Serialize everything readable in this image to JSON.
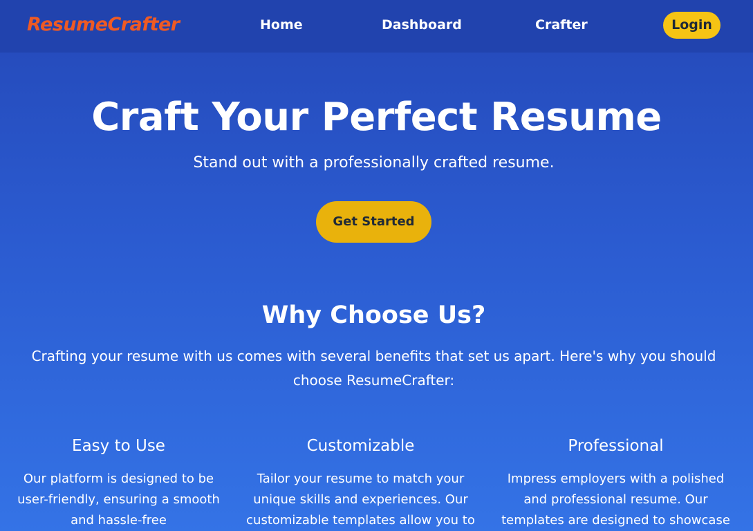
{
  "nav": {
    "brand": "ResumeCrafter",
    "links": [
      {
        "label": "Home"
      },
      {
        "label": "Dashboard"
      },
      {
        "label": "Crafter"
      }
    ],
    "login_label": "Login"
  },
  "hero": {
    "title": "Craft Your Perfect Resume",
    "subtitle": "Stand out with a professionally crafted resume.",
    "cta_label": "Get Started"
  },
  "why": {
    "title": "Why Choose Us?",
    "description": "Crafting your resume with us comes with several benefits that set us apart. Here's why you should choose ResumeCrafter:",
    "features": [
      {
        "title": "Easy to Use",
        "text": "Our platform is designed to be user-friendly, ensuring a smooth and hassle-free"
      },
      {
        "title": "Customizable",
        "text": "Tailor your resume to match your unique skills and experiences. Our customizable templates allow you to"
      },
      {
        "title": "Professional",
        "text": "Impress employers with a polished and professional resume. Our templates are designed to showcase"
      }
    ]
  },
  "colors": {
    "brand": "#ee5a24",
    "nav_bg": "#2143ae",
    "login_bg": "#f6c414",
    "cta_bg": "#e9b20c",
    "page_gradient_top": "#2448b8",
    "page_gradient_bottom": "#3473e6"
  }
}
